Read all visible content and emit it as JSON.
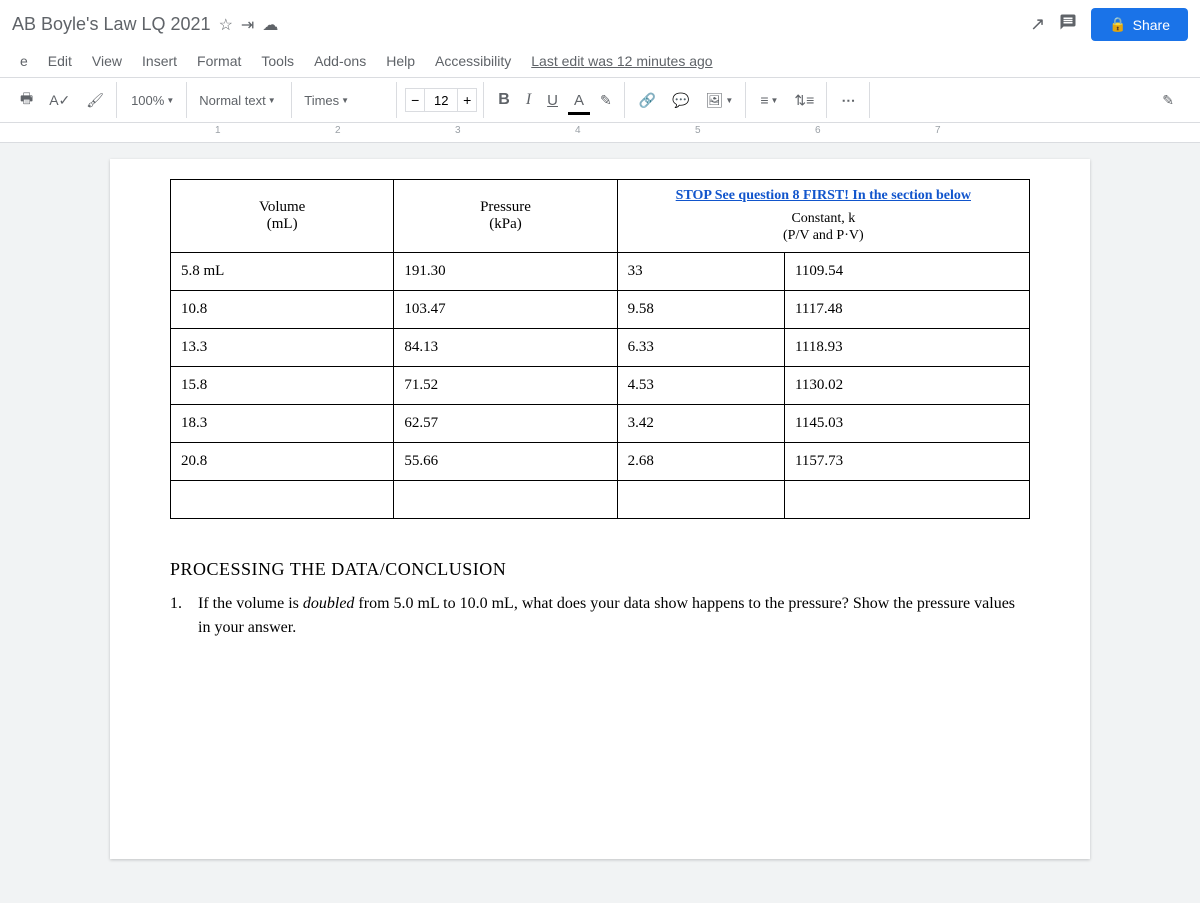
{
  "header": {
    "doc_title": "AB Boyle's Law LQ 2021",
    "share_label": "Share"
  },
  "menubar": {
    "items": [
      "e",
      "Edit",
      "View",
      "Insert",
      "Format",
      "Tools",
      "Add-ons",
      "Help",
      "Accessibility"
    ],
    "last_edit": "Last edit was 12 minutes ago"
  },
  "toolbar": {
    "zoom": "100%",
    "style": "Normal text",
    "font": "Times",
    "font_size": "12",
    "bold": "B",
    "italic": "I",
    "underline": "U",
    "text_color": "A"
  },
  "ruler": {
    "numbers": [
      "1",
      "2",
      "3",
      "4",
      "5",
      "6",
      "7"
    ]
  },
  "table": {
    "headers": {
      "volume": "Volume\n(mL)",
      "pressure": "Pressure\n(kPa)",
      "stop_note": "STOP See question 8  FIRST! In the section below",
      "constant_label": "Constant, k",
      "constant_sub": "(P/V   and     P·V)"
    },
    "rows": [
      {
        "vol": "5.8 mL",
        "press": "191.30",
        "pv1": "33",
        "pv2": "1109.54"
      },
      {
        "vol": "10.8",
        "press": "103.47",
        "pv1": "9.58",
        "pv2": "1117.48"
      },
      {
        "vol": "13.3",
        "press": "84.13",
        "pv1": "6.33",
        "pv2": "1118.93"
      },
      {
        "vol": "15.8",
        "press": "71.52",
        "pv1": "4.53",
        "pv2": "1130.02"
      },
      {
        "vol": "18.3",
        "press": "62.57",
        "pv1": "3.42",
        "pv2": "1145.03"
      },
      {
        "vol": "20.8",
        "press": "55.66",
        "pv1": "2.68",
        "pv2": "1157.73"
      }
    ]
  },
  "body": {
    "section_heading": "PROCESSING THE DATA/CONCLUSION",
    "q1_num": "1.",
    "q1_a": "If the volume is ",
    "q1_doubled": "doubled",
    "q1_b": " from 5.0 mL to 10.0 mL, what does your data show happens to the pressure? Show the pressure values in your answer."
  }
}
